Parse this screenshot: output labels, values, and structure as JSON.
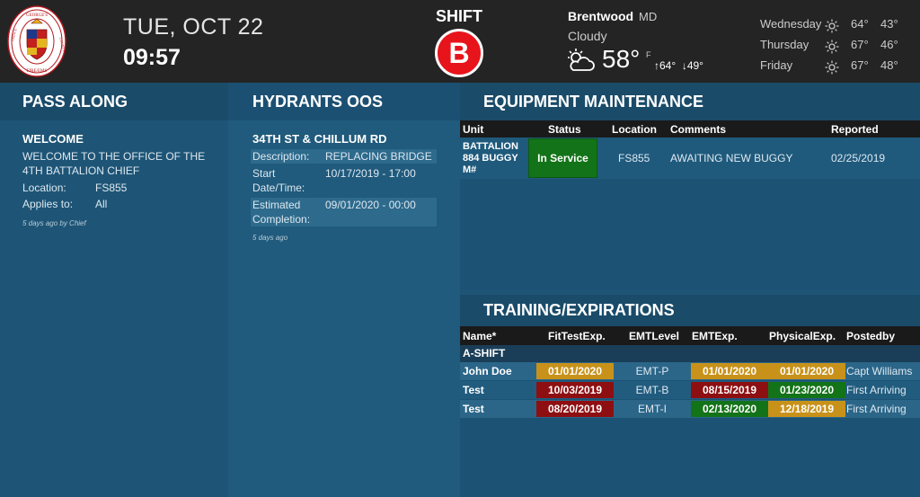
{
  "header": {
    "logo_text": [
      "PRINCE",
      "GEORGE'S",
      "COUNTY",
      "FIRE/EMS"
    ],
    "date": "TUE, OCT 22",
    "time": "09:57",
    "shift_label": "SHIFT",
    "shift_value": "B",
    "colors": {
      "shift_badge": "#e8141c",
      "header_bg": "#242424"
    }
  },
  "weather": {
    "city": "Brentwood",
    "state": "MD",
    "condition": "Cloudy",
    "current_icon": "partly-cloudy-icon",
    "current_temp": "58°",
    "unit": "F",
    "high": "64°",
    "low": "49°",
    "forecast": [
      {
        "day": "Wednesday",
        "icon": "sun-icon",
        "high": "64°",
        "low": "43°"
      },
      {
        "day": "Thursday",
        "icon": "sun-icon",
        "high": "67°",
        "low": "46°"
      },
      {
        "day": "Friday",
        "icon": "sun-icon",
        "high": "67°",
        "low": "48°"
      }
    ]
  },
  "pass_along": {
    "title": "PASS ALONG",
    "item_title": "WELCOME",
    "message": "WELCOME TO THE OFFICE OF THE 4TH BATTALION CHIEF",
    "location_label": "Location:",
    "location_value": "FS855",
    "applies_label": "Applies to:",
    "applies_value": "All",
    "footer": "5 days ago by Chief"
  },
  "hydrants": {
    "title": "HYDRANTS OOS",
    "item_title": "34TH ST & CHILLUM RD",
    "description_label": "Description:",
    "description_value": "REPLACING BRIDGE",
    "start_label": "Start Date/Time:",
    "start_value": "10/17/2019 - 17:00",
    "completion_label": "Estimated Completion:",
    "completion_value": "09/01/2020 - 00:00",
    "footer": "5 days ago"
  },
  "equipment": {
    "title": "EQUIPMENT MAINTENANCE",
    "columns": [
      "Unit",
      "Status",
      "Location",
      "Comments",
      "Reported"
    ],
    "rows": [
      {
        "unit": "BATTALION 884 BUGGY M#",
        "status": "In Service",
        "location": "FS855",
        "comments": "AWAITING NEW BUGGY",
        "reported": "02/25/2019"
      }
    ],
    "colors": {
      "in_service": "#137318"
    }
  },
  "training": {
    "title": "TRAINING/EXPIRATIONS",
    "columns": [
      "Name*",
      "FitTestExp.",
      "EMTLevel",
      "EMTExp.",
      "PhysicalExp.",
      "Postedby"
    ],
    "group": "A-SHIFT",
    "rows": [
      {
        "name": "John Doe",
        "fit": "01/01/2020",
        "level": "EMT-P",
        "emt": "01/01/2020",
        "phys": "01/01/2020",
        "posted": "Capt Williams"
      },
      {
        "name": "Test",
        "fit": "10/03/2019",
        "level": "EMT-B",
        "emt": "08/15/2019",
        "phys": "01/23/2020",
        "posted": "First Arriving"
      },
      {
        "name": "Test",
        "fit": "08/20/2019",
        "level": "EMT-I",
        "emt": "02/13/2020",
        "phys": "12/18/2019",
        "posted": "First Arriving"
      }
    ],
    "colors": {
      "warning": "#c8921a",
      "expired": "#8e0f12",
      "ok": "#137318"
    }
  }
}
